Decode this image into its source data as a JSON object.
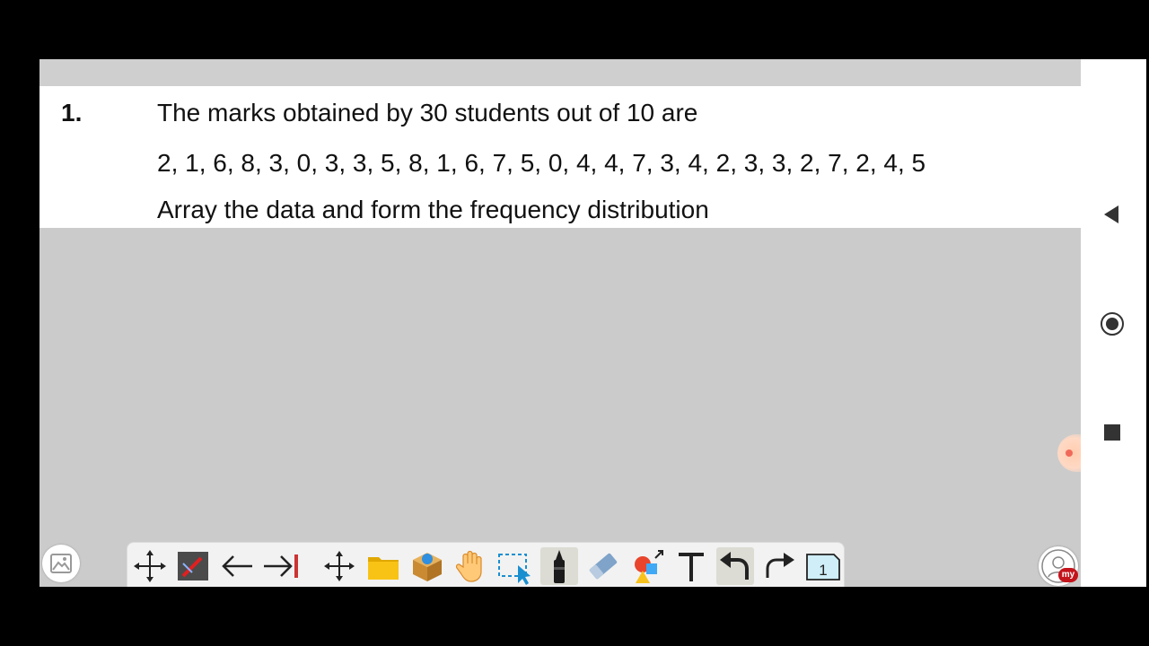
{
  "question": {
    "number": "1.",
    "line1": "The marks obtained by 30 students out of 10 are",
    "line2": "2, 1, 6, 8, 3, 0, 3, 3, 5, 8, 1, 6, 7, 5, 0, 4, 4, 7, 3, 4, 2, 3, 3, 2, 7, 2, 4, 5",
    "line3": "Array the data and form the frequency distribution"
  },
  "toolbar": {
    "tools": [
      {
        "icon": "move-icon"
      },
      {
        "icon": "pen-settings-icon"
      },
      {
        "icon": "previous-arrow-icon"
      },
      {
        "icon": "next-arrow-icon"
      },
      {
        "icon": "pan-arrows-icon"
      },
      {
        "icon": "folder-icon"
      },
      {
        "icon": "resources-box-icon"
      },
      {
        "icon": "hand-icon"
      },
      {
        "icon": "selection-icon"
      },
      {
        "icon": "marker-icon"
      },
      {
        "icon": "eraser-icon"
      },
      {
        "icon": "shapes-icon"
      },
      {
        "icon": "text-icon"
      },
      {
        "icon": "undo-icon"
      },
      {
        "icon": "redo-icon"
      },
      {
        "icon": "page-icon"
      }
    ],
    "page_number": "1"
  },
  "avatar_badge": "my",
  "colors": {
    "canvas": "#cbcbcb",
    "question_bg": "#ffffff",
    "folder": "#f9c316",
    "badge": "#c4141c",
    "page_icon": "#cfeef7"
  }
}
